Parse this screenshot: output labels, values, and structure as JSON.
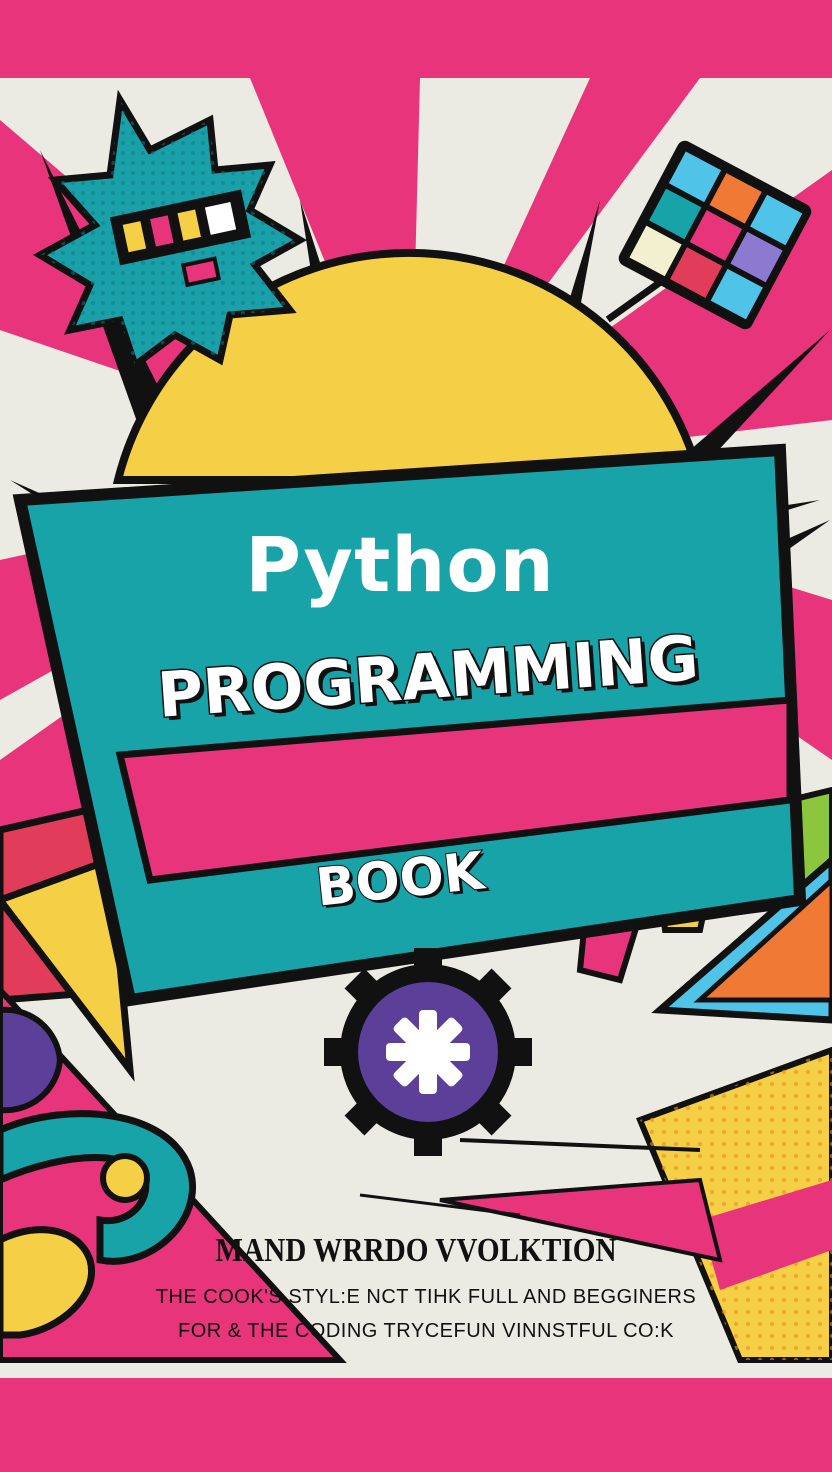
{
  "cover": {
    "title_line1": "Python",
    "title_line2": "PROGRAMMING",
    "title_line3": "BOOK",
    "author_line": "MAND WRRDO VVOLKTION",
    "tagline_line1": "THE COOK'S STYL:E NCT  TIHK FULL  AND BEGGINERS",
    "tagline_line2": "FOR & THE CODING TRYCEFUN VINNSTFUL CO:K"
  },
  "colors": {
    "magenta": "#e8347a",
    "teal": "#17a3a8",
    "yellow": "#f5cf45",
    "cream": "#ecebe3",
    "purple": "#5b3f98",
    "orange": "#f07a35",
    "green": "#8cc63f",
    "ink": "#111111"
  },
  "icons": [
    "starburst-icon",
    "color-grid-icon",
    "gear-asterisk-icon",
    "python-swirl-icon"
  ]
}
